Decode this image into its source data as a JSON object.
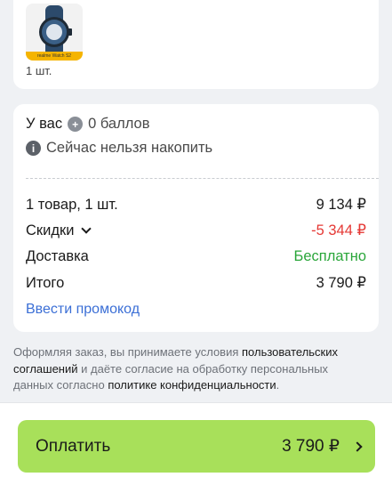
{
  "product": {
    "thumb_label": "realme Watch S2",
    "quantity": "1 шт."
  },
  "points": {
    "prefix": "У вас",
    "balance": "0 баллов",
    "notice": "Сейчас нельзя накопить"
  },
  "summary": {
    "items_label": "1 товар, 1 шт.",
    "items_value": "9 134 ₽",
    "discount_label": "Скидки",
    "discount_value": "-5 344 ₽",
    "delivery_label": "Доставка",
    "delivery_value": "Бесплатно",
    "total_label": "Итого",
    "total_value": "3 790 ₽",
    "promo_link": "Ввести промокод"
  },
  "legal": {
    "part1": "Оформляя заказ, вы принимаете условия ",
    "link1": "пользовательских соглашений",
    "part2": " и даёте согласие на обработку персональных данных согласно ",
    "link2": "политике конфиденциальности",
    "part3": "."
  },
  "pay": {
    "label": "Оплатить",
    "amount": "3 790 ₽"
  },
  "colors": {
    "accent_green": "#a8e05a",
    "discount_red": "#e53935",
    "free_green": "#2aa63a",
    "link_blue": "#3b6fd6"
  }
}
